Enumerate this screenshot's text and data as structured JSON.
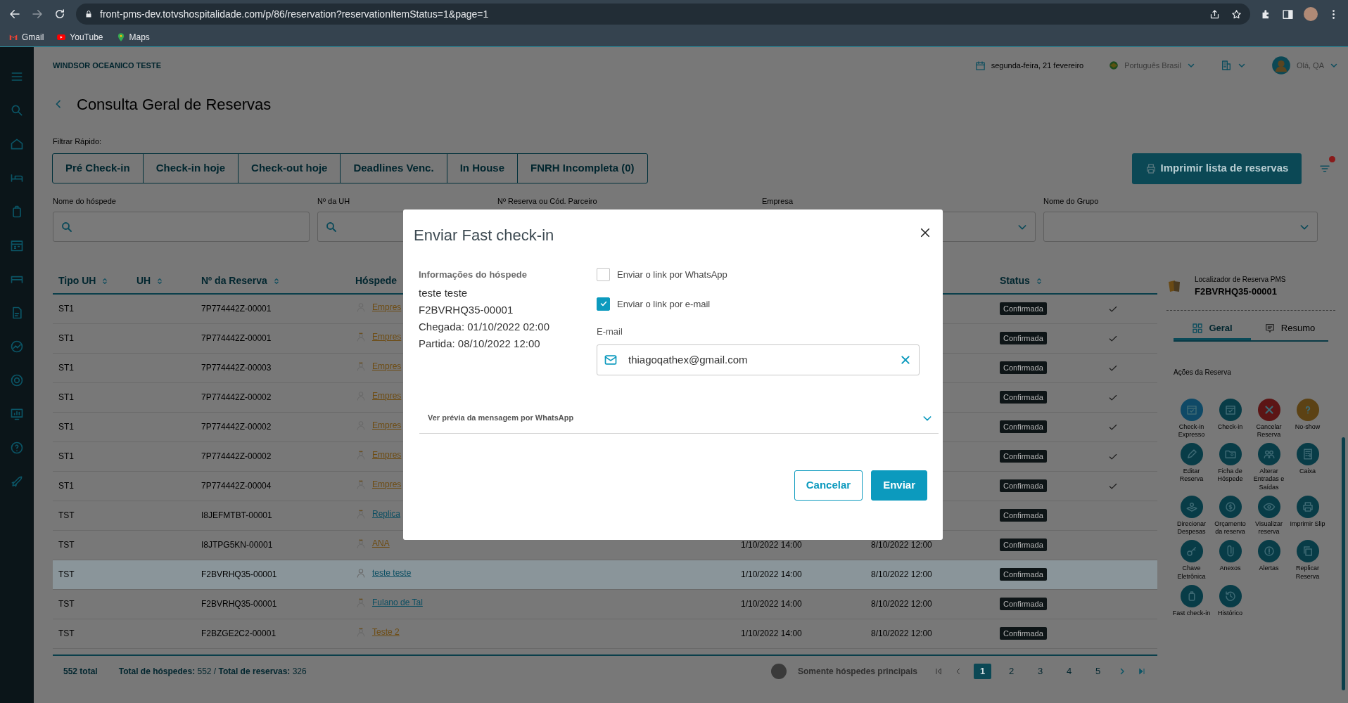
{
  "browser": {
    "url": "front-pms-dev.totvshospitalidade.com/p/86/reservation?reservationItemStatus=1&page=1",
    "bookmarks": [
      "Gmail",
      "YouTube",
      "Maps"
    ]
  },
  "header": {
    "hotel": "WINDSOR OCEANICO TESTE",
    "date": "segunda-feira, 21 fevereiro",
    "language": "Português Brasil",
    "greeting": "Olá, QA"
  },
  "page_title": "Consulta Geral de Reservas",
  "quick_filter": {
    "label": "Filtrar Rápido:",
    "buttons": [
      "Pré Check-in",
      "Check-in hoje",
      "Check-out hoje",
      "Deadlines Venc.",
      "In House",
      "FNRH Incompleta (0)"
    ]
  },
  "print_button": "Imprimir lista de reservas",
  "filters": [
    {
      "label": "Nome do hóspede",
      "kind": "search"
    },
    {
      "label": "Nº da UH",
      "kind": "search"
    },
    {
      "label": "Nº Reserva ou Cód. Parceiro",
      "kind": "covered"
    },
    {
      "label": "Empresa",
      "kind": "select"
    },
    {
      "label": "Nome do Grupo",
      "kind": "select"
    }
  ],
  "table": {
    "columns": [
      {
        "label": "Tipo UH"
      },
      {
        "label": "UH"
      },
      {
        "label": "Nº da Reserva"
      },
      {
        "label": "Hóspede"
      },
      {
        "label": "Status"
      }
    ],
    "rows": [
      {
        "type": "ST1",
        "reservation": "7P774442Z-00001",
        "guest": "Empres",
        "vip": false,
        "color": "#6e4c12",
        "status": "Confirmada",
        "checked": true,
        "selected": false
      },
      {
        "type": "ST1",
        "reservation": "7P774442Z-00001",
        "guest": "Empres",
        "vip": true,
        "color": "#6e4c12",
        "status": "Confirmada",
        "checked": true,
        "selected": false
      },
      {
        "type": "ST1",
        "reservation": "7P774442Z-00003",
        "guest": "Empres",
        "vip": true,
        "color": "#6e4c12",
        "status": "Confirmada",
        "checked": true,
        "selected": false
      },
      {
        "type": "ST1",
        "reservation": "7P774442Z-00002",
        "guest": "Empres",
        "vip": false,
        "color": "#6e4c12",
        "status": "Confirmada",
        "checked": true,
        "selected": false
      },
      {
        "type": "ST1",
        "reservation": "7P774442Z-00002",
        "guest": "Empres",
        "vip": false,
        "color": "#6e4c12",
        "status": "Confirmada",
        "checked": true,
        "selected": false
      },
      {
        "type": "ST1",
        "reservation": "7P774442Z-00002",
        "guest": "Empres",
        "vip": true,
        "color": "#6e4c12",
        "status": "Confirmada",
        "checked": true,
        "selected": false
      },
      {
        "type": "ST1",
        "reservation": "7P774442Z-00004",
        "guest": "Empres",
        "vip": true,
        "color": "#6e4c12",
        "status": "Confirmada",
        "checked": true,
        "selected": false
      },
      {
        "type": "TST",
        "reservation": "I8JEFMTBT-00001",
        "guest": "Replica",
        "vip": true,
        "color": "#0b4e62",
        "status": "Confirmada",
        "checked": false,
        "selected": false
      },
      {
        "type": "TST",
        "reservation": "I8JTPG5KN-00001",
        "guest": "ANA",
        "vip": true,
        "color": "#6e4c12",
        "arrival": "1/10/2022 14:00",
        "departure": "8/10/2022 12:00",
        "status": "Confirmada",
        "checked": false,
        "selected": false
      },
      {
        "type": "TST",
        "reservation": "F2BVRHQ35-00001",
        "guest": "teste teste",
        "vip": false,
        "color": "#0b4e62",
        "arrival": "1/10/2022 14:00",
        "departure": "8/10/2022 12:00",
        "status": "Confirmada",
        "checked": false,
        "selected": true
      },
      {
        "type": "TST",
        "reservation": "F2BVRHQ35-00001",
        "guest": "Fulano de Tal",
        "vip": true,
        "color": "#0b4e62",
        "arrival": "1/10/2022 14:00",
        "departure": "8/10/2022 12:00",
        "status": "Confirmada",
        "checked": false,
        "selected": false
      },
      {
        "type": "TST",
        "reservation": "F2BZGE2C2-00001",
        "guest": "Teste 2",
        "vip": true,
        "color": "#6e4c12",
        "arrival": "1/10/2022 14:00",
        "departure": "8/10/2022 12:00",
        "status": "Confirmada",
        "checked": false,
        "selected": false
      }
    ]
  },
  "footer": {
    "total": "552 total",
    "summary": "**Total de hóspedes:** 552 / **Total de reservas:** 326",
    "toggle": {
      "label": "Somente hóspedes principais",
      "on": false
    },
    "pages": [
      {
        "label": "1",
        "selected": true
      },
      {
        "label": "2",
        "selected": false
      },
      {
        "label": "3",
        "selected": false
      },
      {
        "label": "4",
        "selected": false
      },
      {
        "label": "5",
        "selected": false
      }
    ]
  },
  "side_panel": {
    "locator_label": "Localizador de Reserva PMS",
    "locator": "F2BVRHQ35-00001",
    "tabs": [
      {
        "label": "Geral",
        "selected": true
      },
      {
        "label": "Resumo",
        "selected": false
      }
    ],
    "actions_title": "Ações da Reserva",
    "actions": [
      {
        "label": "Check-in Expresso",
        "color": "#0f4966"
      },
      {
        "label": "Check-in",
        "color": "#083c47"
      },
      {
        "label": "Cancelar Reserva",
        "color": "#5c1515"
      },
      {
        "label": "No-show",
        "color": "#5c4214"
      },
      {
        "label": "Editar Reserva",
        "color": "#083c47"
      },
      {
        "label": "Ficha de Hóspede",
        "color": "#083c47"
      },
      {
        "label": "Alterar Entradas e Saídas",
        "color": "#083c47"
      },
      {
        "label": "Caixa",
        "color": "#083c47"
      },
      {
        "label": "Direcionar Despesas",
        "color": "#083c47"
      },
      {
        "label": "Orçamento da reserva",
        "color": "#083c47"
      },
      {
        "label": "Visualizar reserva",
        "color": "#083c47"
      },
      {
        "label": "Imprimir Slip",
        "color": "#083c47"
      },
      {
        "label": "Chave Eletrônica",
        "color": "#083c47"
      },
      {
        "label": "Anexos",
        "color": "#083c47"
      },
      {
        "label": "Alertas",
        "color": "#083c47"
      },
      {
        "label": "Replicar Reserva",
        "color": "#083c47"
      },
      {
        "label": "Fast check-in",
        "color": "#083c47"
      },
      {
        "label": "Histórico",
        "color": "#083c47"
      }
    ]
  },
  "modal": {
    "title": "Enviar Fast check-in",
    "info_title": "Informações do hóspede",
    "info_lines": [
      "teste teste",
      "F2BVRHQ35-00001",
      "Chegada: 01/10/2022 02:00",
      "Partida: 08/10/2022 12:00"
    ],
    "options": [
      {
        "label": "Enviar o link por WhatsApp",
        "checked": false
      },
      {
        "label": "Enviar o link por e-mail",
        "checked": true
      }
    ],
    "email_label": "E-mail",
    "email_value": "thiagoqathex@gmail.com",
    "preview": {
      "label": "Ver prévia da mensagem por WhatsApp",
      "expanded": false
    },
    "buttons": [
      {
        "label": "Cancelar",
        "kind": "secondary"
      },
      {
        "label": "Enviar",
        "kind": "primary"
      }
    ]
  }
}
